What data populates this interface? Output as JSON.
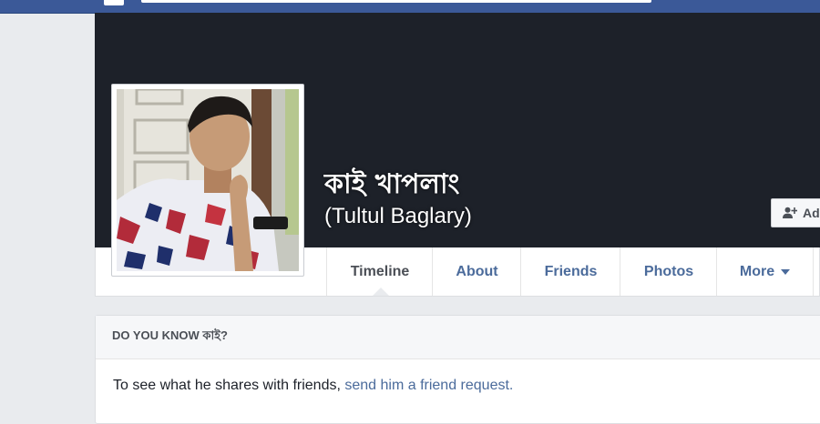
{
  "profile": {
    "name": "কাই খাপলাং",
    "alternate_name": "(Tultul Baglary)"
  },
  "actions": {
    "add_friend_label": "Ad"
  },
  "nav": {
    "tabs": [
      {
        "label": "Timeline",
        "active": true
      },
      {
        "label": "About"
      },
      {
        "label": "Friends"
      },
      {
        "label": "Photos"
      },
      {
        "label": "More"
      }
    ]
  },
  "do_you_know": {
    "header": "DO YOU KNOW কাই?",
    "body_text": "To see what he shares with friends,",
    "link_text": "send him a friend request."
  },
  "icons": {
    "facebook_logo": "facebook-logo-icon",
    "add_friend": "add-friend-icon",
    "more_caret": "caret-down-icon"
  },
  "colors": {
    "top_bar": "#3b5998",
    "cover": "#1d2129",
    "link": "#4b6b9b",
    "page_background": "#e9ebee"
  }
}
